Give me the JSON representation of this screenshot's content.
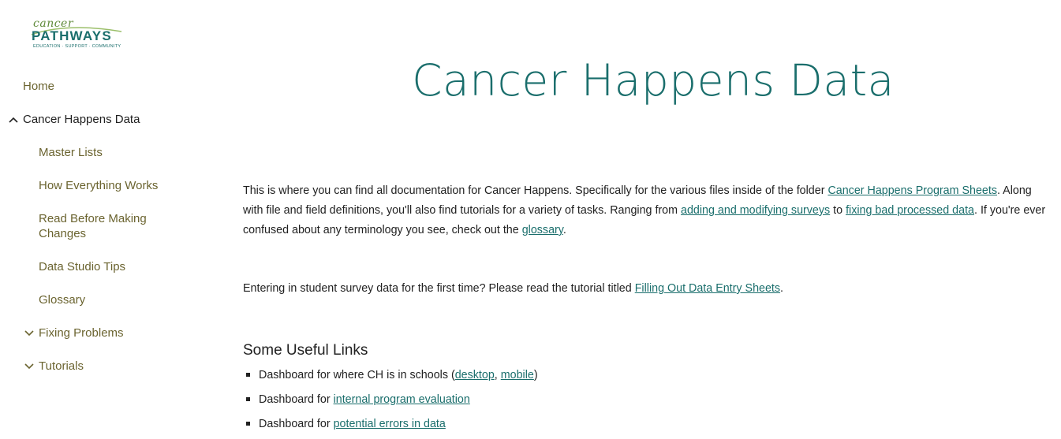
{
  "logo": {
    "script": "cancer",
    "word": "PATHWAYS",
    "tagline": "EDUCATION · SUPPORT · COMMUNITY"
  },
  "nav": {
    "home": "Home",
    "cancer_happens_data": "Cancer Happens Data",
    "master_lists": "Master Lists",
    "how_everything_works": "How Everything Works",
    "read_before_1": "Read Before Making",
    "read_before_2": "Changes",
    "data_studio_tips": "Data Studio Tips",
    "glossary": "Glossary",
    "fixing_problems": "Fixing Problems",
    "tutorials": "Tutorials"
  },
  "page": {
    "title": "Cancer Happens Data",
    "intro": {
      "t1": "This is where you can find all documentation for Cancer Happens. Specifically for the various files inside of the folder ",
      "link_program_sheets": "Cancer Happens Program Sheets",
      "t2": ". Along with file and field definitions, you'll also find tutorials for a variety of tasks. Ranging from ",
      "link_adding_surveys": "adding and modifying surveys",
      "t3": " to ",
      "link_fixing_data": "fixing bad processed data",
      "t4": ". If you're ever confused about any terminology you see, check out the ",
      "link_glossary": "glossary",
      "t5": "."
    },
    "entering": {
      "t1": "Entering in student survey data for the first time? Please read the tutorial titled ",
      "link": "Filling Out Data Entry Sheets",
      "t2": "."
    },
    "useful_links_heading": "Some Useful Links",
    "useful_links": {
      "item1_text": "Dashboard for where CH is in schools (",
      "item1_link_desktop": "desktop",
      "item1_sep": ", ",
      "item1_link_mobile": "mobile",
      "item1_end": ")",
      "item2_text": "Dashboard for ",
      "item2_link": "internal program evaluation",
      "item3_text": "Dashboard for ",
      "item3_link": "potential errors in data"
    }
  },
  "colors": {
    "accent": "#1a6e6c",
    "nav_text": "#6b6430",
    "body_text": "#212121",
    "logo_green": "#5f8a3a"
  }
}
